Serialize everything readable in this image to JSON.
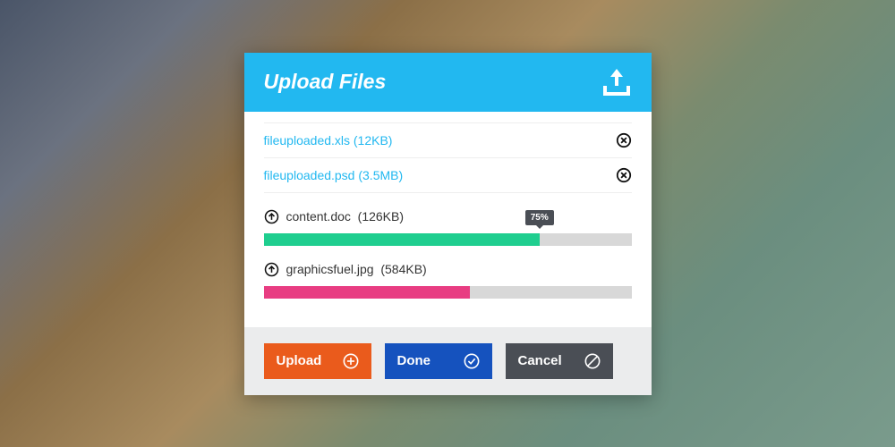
{
  "header": {
    "title": "Upload Files"
  },
  "completed": [
    {
      "name": "fileuploaded.xls",
      "size": "(12KB)"
    },
    {
      "name": "fileuploaded.psd",
      "size": "(3.5MB)"
    }
  ],
  "uploading": [
    {
      "name": "content.doc",
      "size": "(126KB)",
      "progress": 75,
      "color": "green",
      "showTooltip": true
    },
    {
      "name": "graphicsfuel.jpg",
      "size": "(584KB)",
      "progress": 56,
      "color": "pink",
      "showTooltip": false
    }
  ],
  "buttons": {
    "upload": "Upload",
    "done": "Done",
    "cancel": "Cancel"
  },
  "colors": {
    "headerBg": "#22b8f0",
    "green": "#1fce8f",
    "pink": "#e83d82",
    "orange": "#ea5b1c",
    "blue": "#1552be",
    "gray": "#4a4e55"
  }
}
